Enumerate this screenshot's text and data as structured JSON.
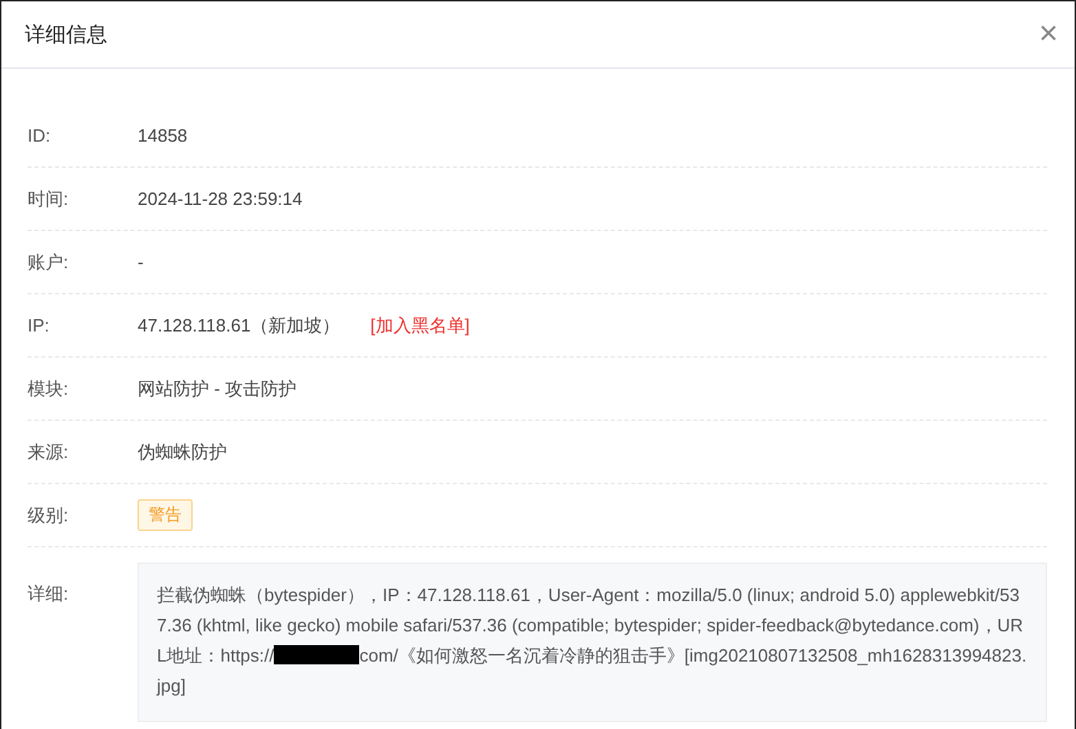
{
  "dialog": {
    "title": "详细信息",
    "close": "×"
  },
  "fields": [
    {
      "kind": "text",
      "label": "ID:",
      "value": "14858"
    },
    {
      "kind": "text",
      "label": "时间:",
      "value": "2024-11-28 23:59:14"
    },
    {
      "kind": "text",
      "label": "账户:",
      "value": "-"
    },
    {
      "kind": "ip",
      "label": "IP:",
      "value": "47.128.118.61（新加坡）",
      "link": "[加入黑名单]"
    },
    {
      "kind": "text",
      "label": "模块:",
      "value": "网站防护 - 攻击防护"
    },
    {
      "kind": "text",
      "label": "来源:",
      "value": "伪蜘蛛防护"
    },
    {
      "kind": "tag",
      "label": "级别:",
      "value": "警告"
    },
    {
      "kind": "detail",
      "label": "详细:",
      "segments": [
        {
          "kind": "text",
          "text": "拦截伪蜘蛛（bytespider），IP：47.128.118.61，User-Agent：mozilla/5.0 (linux; android 5.0) applewebkit/537.36 (khtml, like gecko) mobile safari/537.36 (compatible; bytespider; spider-feedback@bytedance.com)，URL地址：https://"
        },
        {
          "kind": "redacted"
        },
        {
          "kind": "text",
          "text": "com/《如何激怒一名沉着冷静的狙击手》[img20210807132508_mh1628313994823.jpg]"
        }
      ]
    }
  ]
}
